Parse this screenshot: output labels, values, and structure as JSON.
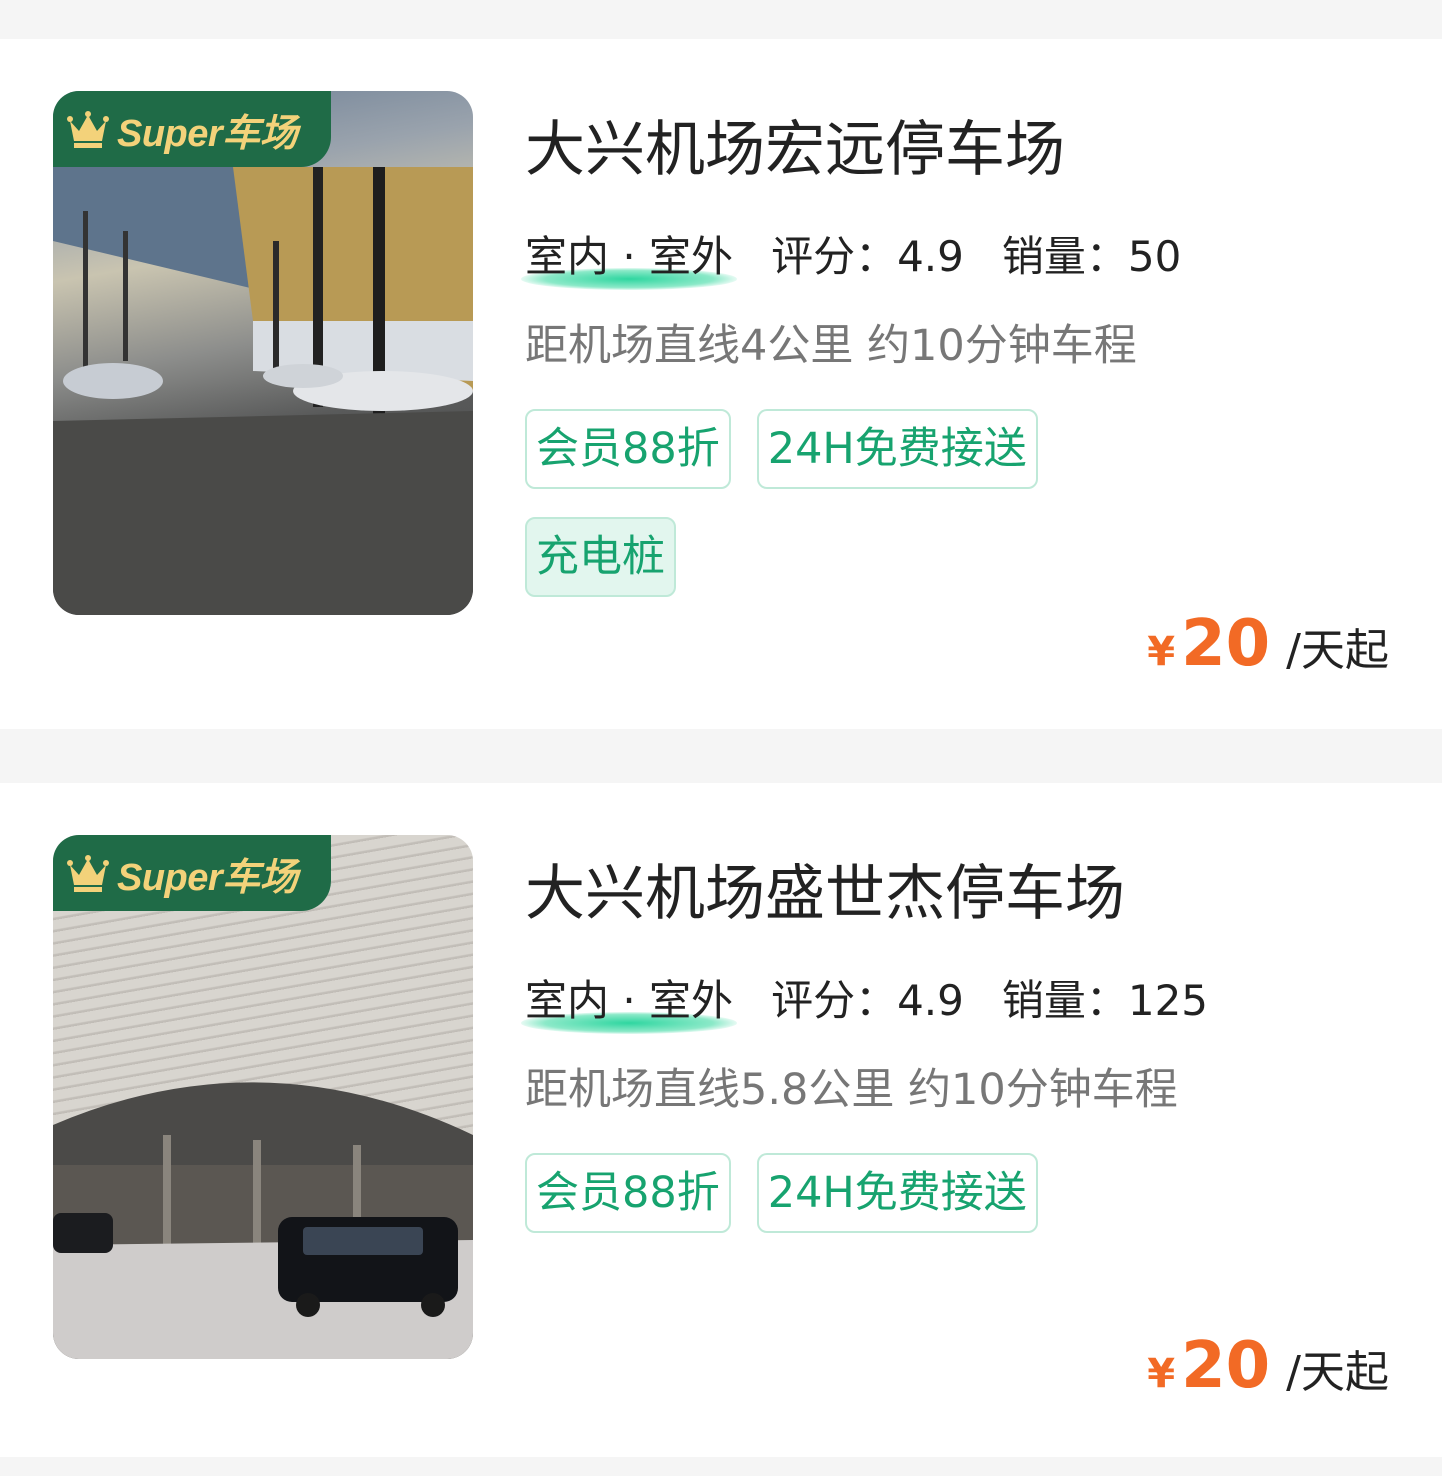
{
  "colors": {
    "accent_green": "#17a36f",
    "badge_green": "#1f6b47",
    "price_orange": "#f26a25",
    "text_dark": "#222222",
    "text_gray": "#777777"
  },
  "listings": [
    {
      "badge": "Super车场",
      "badge_icon": "crown-icon",
      "title": "大兴机场宏远停车场",
      "location": "室内 · 室外",
      "rating": "评分：4.9",
      "sales": "销量：50",
      "distance": "距机场直线4公里 约10分钟车程",
      "tags": [
        "会员88折",
        "24H免费接送",
        "充电桩"
      ],
      "price_symbol": "¥",
      "price": "20",
      "price_unit": "/天起"
    },
    {
      "badge": "Super车场",
      "badge_icon": "crown-icon",
      "title": "大兴机场盛世杰停车场",
      "location": "室内 · 室外",
      "rating": "评分：4.9",
      "sales": "销量：125",
      "distance": "距机场直线5.8公里 约10分钟车程",
      "tags": [
        "会员88折",
        "24H免费接送"
      ],
      "price_symbol": "¥",
      "price": "20",
      "price_unit": "/天起"
    }
  ]
}
